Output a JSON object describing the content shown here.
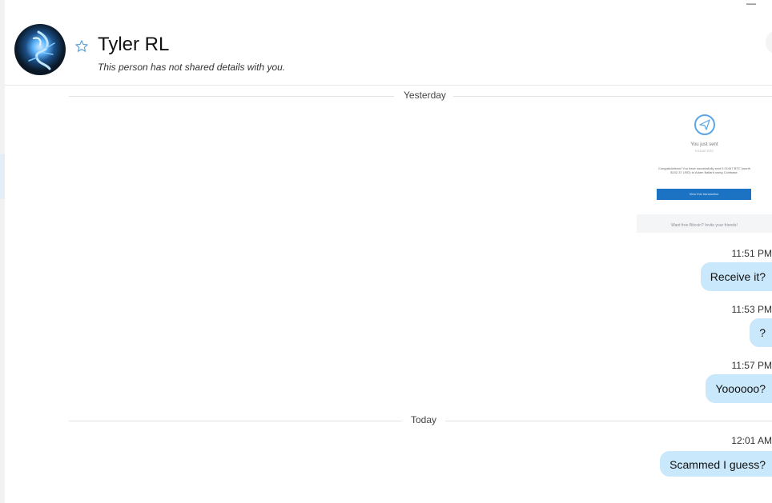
{
  "contact": {
    "name": "Tyler RL",
    "subtitle": "This person has not shared details with you."
  },
  "window": {
    "minimize_symbol": "—"
  },
  "separators": {
    "yesterday": "Yesterday",
    "today": "Today"
  },
  "image_attachment": {
    "title": "You just sent",
    "amount": "0.01447 BTC",
    "body": "Congratulations! You have successfully sent 0.01447 BTC (worth $102.37 USD) to Adam Ballard using Coinbase.",
    "button": "View this transaction",
    "footer": "Want free Bitcoin? Invite your friends!"
  },
  "messages": [
    {
      "time": "11:51 PM",
      "text": "Receive it?"
    },
    {
      "time": "11:53 PM",
      "text": "?"
    },
    {
      "time": "11:57 PM",
      "text": "Yoooooo?"
    },
    {
      "time": "12:01 AM",
      "text": "Scammed I guess?"
    }
  ],
  "icons": {
    "favorite": "star-outline-icon",
    "send": "paper-plane-icon"
  },
  "colors": {
    "bubble": "#c9e8fb",
    "accent": "#1d73c3"
  }
}
